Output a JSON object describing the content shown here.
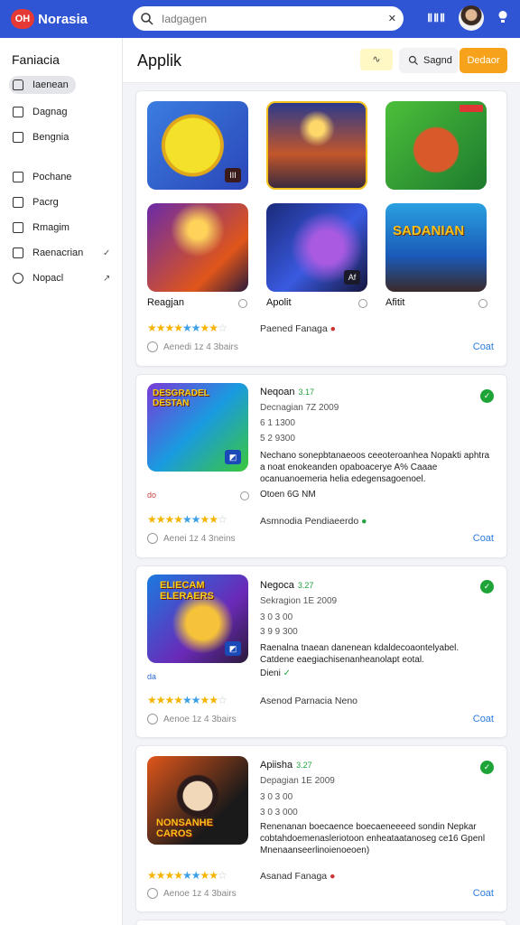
{
  "app": {
    "badge": "OH",
    "name": "Norasia"
  },
  "search": {
    "placeholder": "Iadgagen",
    "clear": "✕"
  },
  "topbar": {
    "apps_label": "ⅡⅡⅡ"
  },
  "sidebar": {
    "title": "Faniacia",
    "items": [
      {
        "label": "Iaenean"
      },
      {
        "label": "Dagnag"
      },
      {
        "label": "Bengnia"
      },
      {
        "label": "Pochane"
      },
      {
        "label": "Pacrg"
      },
      {
        "label": "Rmagim"
      },
      {
        "label": "Raenacrian",
        "chev": "✓"
      },
      {
        "label": "Nopacl",
        "chev": "↗"
      }
    ]
  },
  "header": {
    "title": "Applik",
    "filter": "∿",
    "search_label": "Sagnd",
    "primary": "Dedaor"
  },
  "card1": {
    "games": [
      {
        "name": "Reagjan"
      },
      {
        "name": "Apolit"
      },
      {
        "name": "Afitit"
      }
    ],
    "tag1": "III",
    "tag5": "Af",
    "sadnan": "SADANIAN",
    "rating_label": "Paened Fanaga",
    "time": "Aenedi 1z 4 3bairs",
    "link": "Coat"
  },
  "card2": {
    "title": "Neqoan",
    "ver": "3.17",
    "lines": [
      "Decnagian 7Z 2009",
      "6 1 1300",
      "5 2 9300"
    ],
    "desc": "Nechano sonepbtanaeoos ceeoteroanhea Nopakti aphtra a noat enokeanden opaboacerye A% Caaae ocanuanoemeria helia edegensagoenoel.",
    "small": "Otoen 6G NM",
    "tag": "do",
    "rating_label": "Asmnodia Pendiaeerdo",
    "time": "Aenei 1z 4 3neins",
    "link": "Coat",
    "cover": "DESGRADEL DESTAN"
  },
  "card3": {
    "title": "Negoca",
    "ver": "3.27",
    "lines": [
      "Sekragion 1E 2009",
      "3 0 3 00",
      "3 9 9 300"
    ],
    "desc": "Raenalna tnaean danenean kdaldecoaontelyabel. Catdene eaegiachisenanheanolapt eotal.",
    "small": "Dieni",
    "tag": "da",
    "rating_label": "Asenod Parnacia",
    "rating_extra": "Neno",
    "time": "Aenoe 1z 4 3bairs",
    "link": "Coat",
    "cover": "ELIECAM ELERAERS"
  },
  "card4": {
    "title": "Apiisha",
    "ver": "3.27",
    "lines": [
      "Depagian 1E 2009",
      "3 0 3 00",
      "3 0 3 000"
    ],
    "desc": "Renenanan boecaence boecaeneeeed sondin Nepkar cobtahdoemenasleriotoon enheataatanoseg ce16 Gpenl Mnenaanseerlinoienoeoen)",
    "rating_label": "Asanad Fanaga",
    "time": "Aenoe 1z 4 3bairs",
    "link": "Coat",
    "cover": "NONSANHE CAROS"
  },
  "colors": {
    "topbar": "#2f55d4",
    "accent": "#f7a21b",
    "link": "#2b7de0",
    "verified": "#1da336"
  }
}
